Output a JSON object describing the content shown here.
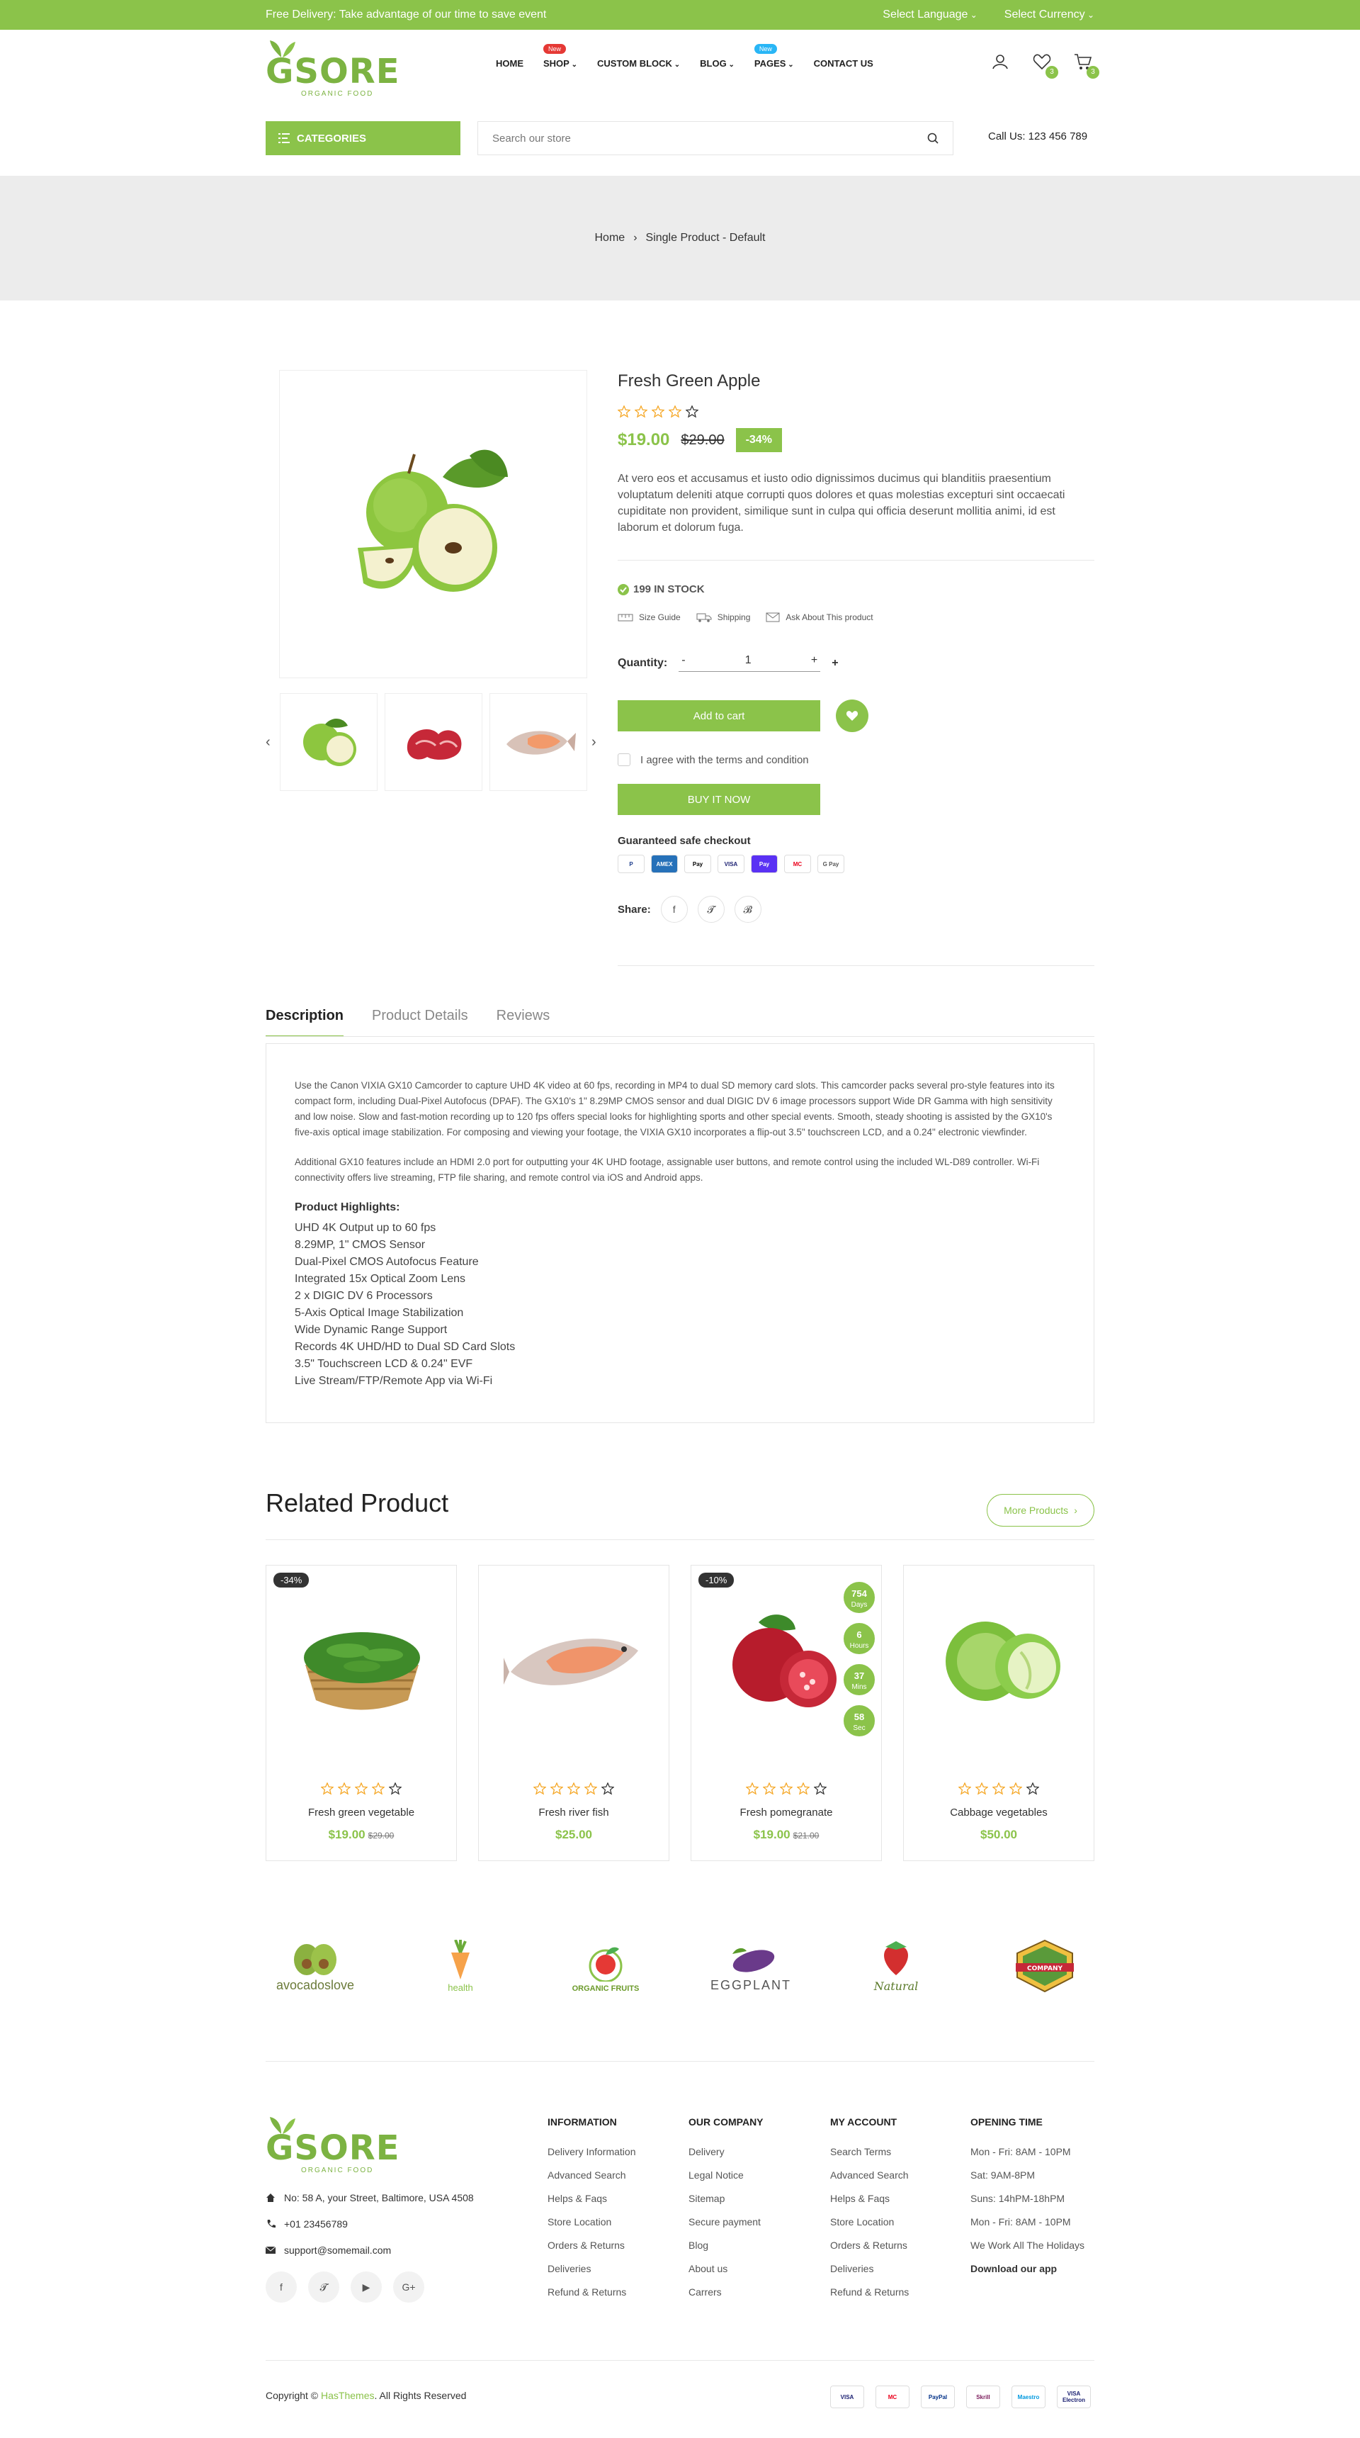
{
  "topbar": {
    "promo": "Free Delivery: Take advantage of our time to save event",
    "language": "Select Language",
    "currency": "Select Currency"
  },
  "logo": {
    "text": "GSORE",
    "sub": "ORGANIC FOOD"
  },
  "nav": [
    {
      "label": "HOME",
      "caret": false,
      "badge": ""
    },
    {
      "label": "SHOP",
      "caret": true,
      "badge": "New"
    },
    {
      "label": "CUSTOM BLOCK",
      "caret": true,
      "badge": ""
    },
    {
      "label": "BLOG",
      "caret": true,
      "badge": ""
    },
    {
      "label": "PAGES",
      "caret": true,
      "badge": "New"
    },
    {
      "label": "CONTACT US",
      "caret": false,
      "badge": ""
    }
  ],
  "header_counts": {
    "wishlist": "3",
    "cart": "3"
  },
  "categories_label": "CATEGORIES",
  "search": {
    "placeholder": "Search our store"
  },
  "callus": "Call Us: 123 456 789",
  "breadcrumb": {
    "home": "Home",
    "current": "Single Product - Default"
  },
  "product": {
    "title": "Fresh Green Apple",
    "rating": 4,
    "price": "$19.00",
    "old_price": "$29.00",
    "discount": "-34%",
    "description": "At vero eos et accusamus et iusto odio dignissimos ducimus qui blanditiis praesentium voluptatum deleniti atque corrupti quos dolores et quas molestias excepturi sint occaecati cupiditate non provident, similique sunt in culpa qui officia deserunt mollitia animi, id est laborum et dolorum fuga.",
    "stock": "199 IN STOCK",
    "size_guide": "Size Guide",
    "shipping": "Shipping",
    "ask": "Ask About This product",
    "quantity_label": "Quantity:",
    "quantity": "1",
    "minus": "-",
    "plus": "+",
    "add_to_cart": "Add to cart",
    "agree": "I agree with the terms and condition",
    "buy_now": "BUY IT NOW",
    "safe_checkout": "Guaranteed safe checkout",
    "share": "Share:"
  },
  "payments": [
    "P",
    "AMEX",
    "Pay",
    "VISA",
    "Pay",
    "MC",
    "G Pay"
  ],
  "tabs": [
    "Description",
    "Product Details",
    "Reviews"
  ],
  "description": {
    "p1": "Use the Canon VIXIA GX10 Camcorder to capture UHD 4K video at 60 fps, recording in MP4 to dual SD memory card slots. This camcorder packs several pro-style features into its compact form, including Dual-Pixel Autofocus (DPAF). The GX10's 1\" 8.29MP CMOS sensor and dual DIGIC DV 6 image processors support Wide DR Gamma with high sensitivity and low noise. Slow and fast-motion recording up to 120 fps offers special looks for highlighting sports and other special events. Smooth, steady shooting is assisted by the GX10's five-axis optical image stabilization. For composing and viewing your footage, the VIXIA GX10 incorporates a flip-out 3.5\" touchscreen LCD, and a 0.24\" electronic viewfinder.",
    "p2": "Additional GX10 features include an HDMI 2.0 port for outputting your 4K UHD footage, assignable user buttons, and remote control using the included WL-D89 controller. Wi-Fi connectivity offers live streaming, FTP file sharing, and remote control via iOS and Android apps.",
    "highlights_title": "Product Highlights:",
    "highlights": [
      "UHD 4K Output up to 60 fps",
      "8.29MP, 1\" CMOS Sensor",
      "Dual-Pixel CMOS Autofocus Feature",
      "Integrated 15x Optical Zoom Lens",
      "2 x DIGIC DV 6 Processors",
      "5-Axis Optical Image Stabilization",
      "Wide Dynamic Range Support",
      "Records 4K UHD/HD to Dual SD Card Slots",
      "3.5\" Touchscreen LCD & 0.24\" EVF",
      "Live Stream/FTP/Remote App via Wi-Fi"
    ]
  },
  "related": {
    "title": "Related Product",
    "more": "More Products",
    "items": [
      {
        "name": "Fresh green vegetable",
        "price": "$19.00",
        "old": "$29.00",
        "tag": "-34%",
        "rating": 4
      },
      {
        "name": "Fresh river fish",
        "price": "$25.00",
        "old": "",
        "tag": "",
        "rating": 4
      },
      {
        "name": "Fresh pomegranate",
        "price": "$19.00",
        "old": "$21.00",
        "tag": "-10%",
        "rating": 4
      },
      {
        "name": "Cabbage vegetables",
        "price": "$50.00",
        "old": "",
        "tag": "",
        "rating": 4
      }
    ],
    "countdown": [
      {
        "v": "754",
        "u": "Days"
      },
      {
        "v": "6",
        "u": "Hours"
      },
      {
        "v": "37",
        "u": "Mins"
      },
      {
        "v": "58",
        "u": "Sec"
      }
    ]
  },
  "brands": [
    "avocadoslove",
    "health",
    "ORGANIC FRUITS",
    "EGGPLANT",
    "Natural",
    "COMPANY"
  ],
  "footer": {
    "address": "No: 58 A, your Street, Baltimore, USA 4508",
    "phone": "+01 23456789",
    "email": "support@somemail.com",
    "cols": [
      {
        "title": "INFORMATION",
        "items": [
          "Delivery Information",
          "Advanced Search",
          "Helps & Faqs",
          "Store Location",
          "Orders & Returns",
          "Deliveries",
          "Refund & Returns"
        ]
      },
      {
        "title": "OUR COMPANY",
        "items": [
          "Delivery",
          "Legal Notice",
          "Sitemap",
          "Secure payment",
          "Blog",
          "About us",
          "Carrers"
        ]
      },
      {
        "title": "MY ACCOUNT",
        "items": [
          "Search Terms",
          "Advanced Search",
          "Helps & Faqs",
          "Store Location",
          "Orders & Returns",
          "Deliveries",
          "Refund & Returns"
        ]
      },
      {
        "title": "OPENING TIME",
        "items": [
          "Mon - Fri: 8AM - 10PM",
          "Sat: 9AM-8PM",
          "Suns: 14hPM-18hPM",
          "Mon - Fri: 8AM - 10PM",
          "We Work All The Holidays",
          "Download our app"
        ]
      }
    ],
    "copy_pre": "Copyright ©",
    "copy_brand": "HasThemes",
    "copy_post": ". All Rights Reserved",
    "payments": [
      "VISA",
      "MC",
      "PayPal",
      "Skrill",
      "Maestro",
      "VISA Electron"
    ]
  },
  "colors": {
    "accent": "#8bc34a",
    "star": "#f5a623"
  }
}
